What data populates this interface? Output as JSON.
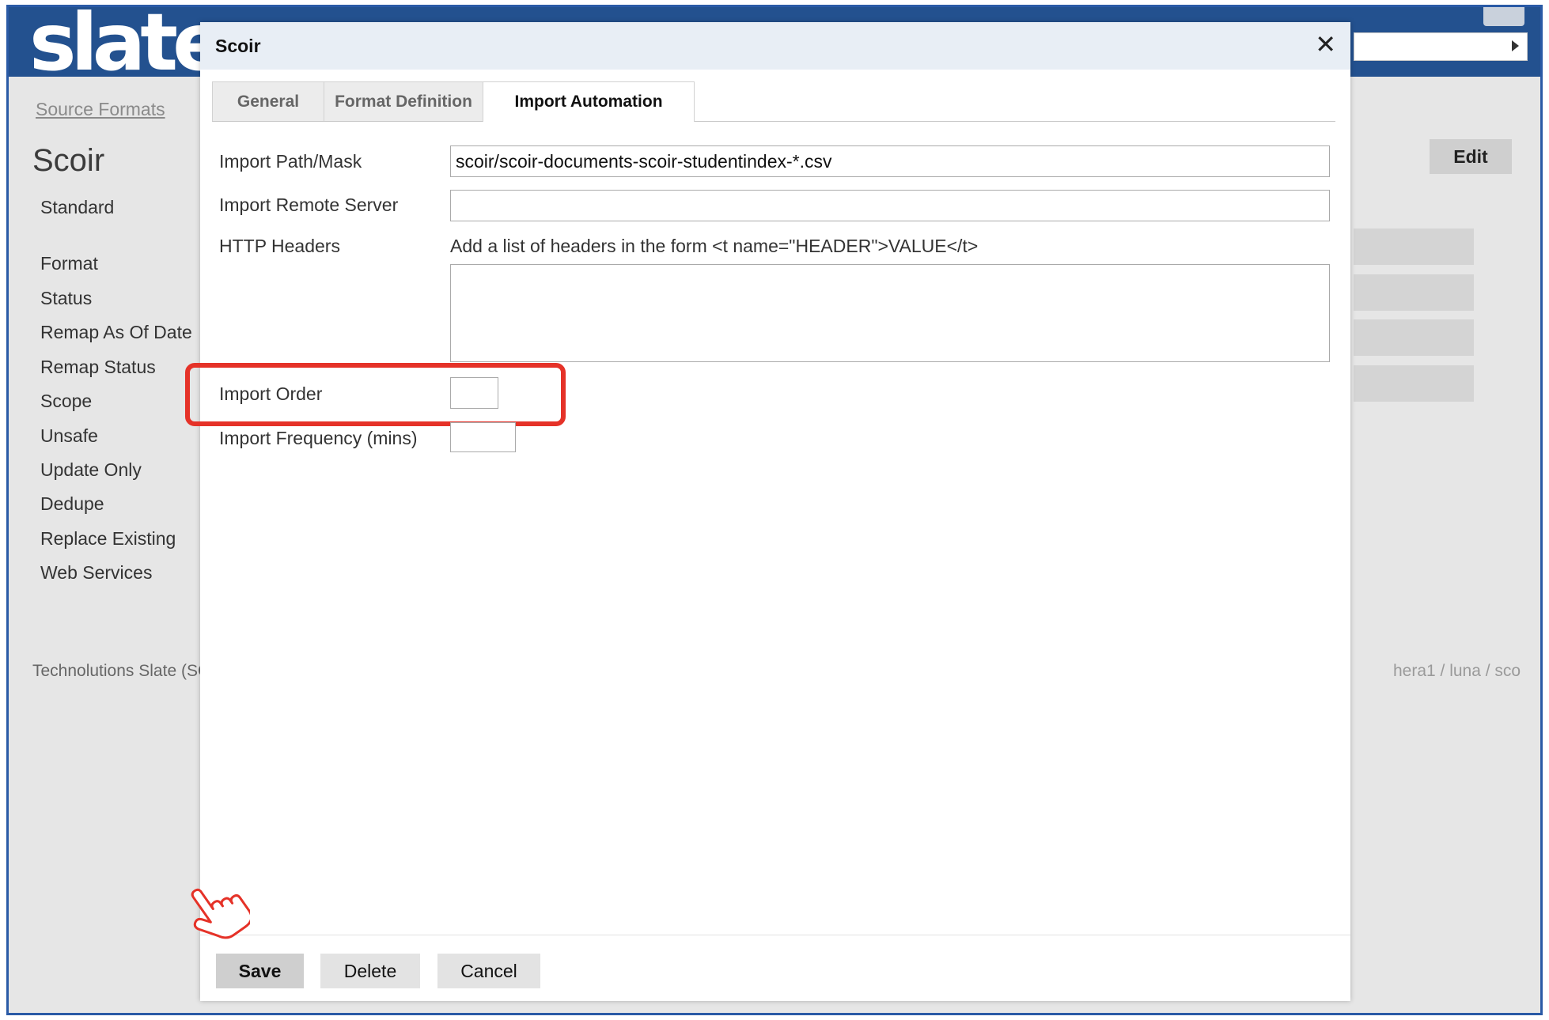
{
  "app": {
    "logo_text": "slate",
    "breadcrumb": "Source Formats",
    "page_title": "Scoir",
    "sidebar": {
      "items": [
        "Standard",
        "Format",
        "Status",
        "Remap As Of Date",
        "Remap Status",
        "Scope",
        "Unsafe",
        "Update Only",
        "Dedupe",
        "Replace Existing",
        "Web Services"
      ]
    },
    "edit_label": "Edit",
    "footer_left": "Technolutions Slate (SC",
    "footer_right": "hera1 / luna / sco"
  },
  "dialog": {
    "title": "Scoir",
    "close_icon": "close-icon",
    "tabs": [
      {
        "label": "General",
        "active": false
      },
      {
        "label": "Format Definition",
        "active": false
      },
      {
        "label": "Import Automation",
        "active": true
      }
    ],
    "fields": {
      "import_path_label": "Import Path/Mask",
      "import_path_value": "scoir/scoir-documents-scoir-studentindex-*.csv",
      "remote_server_label": "Import Remote Server",
      "remote_server_value": "",
      "http_headers_label": "HTTP Headers",
      "http_headers_hint": "Add a list of headers in the form <t name=\"HEADER\">VALUE</t>",
      "http_headers_value": "",
      "import_order_label": "Import Order",
      "import_order_value": "",
      "import_frequency_label": "Import Frequency (mins)",
      "import_frequency_value": ""
    },
    "buttons": {
      "save": "Save",
      "delete": "Delete",
      "cancel": "Cancel"
    }
  },
  "colors": {
    "brand": "#23518f",
    "highlight": "#e53228"
  }
}
